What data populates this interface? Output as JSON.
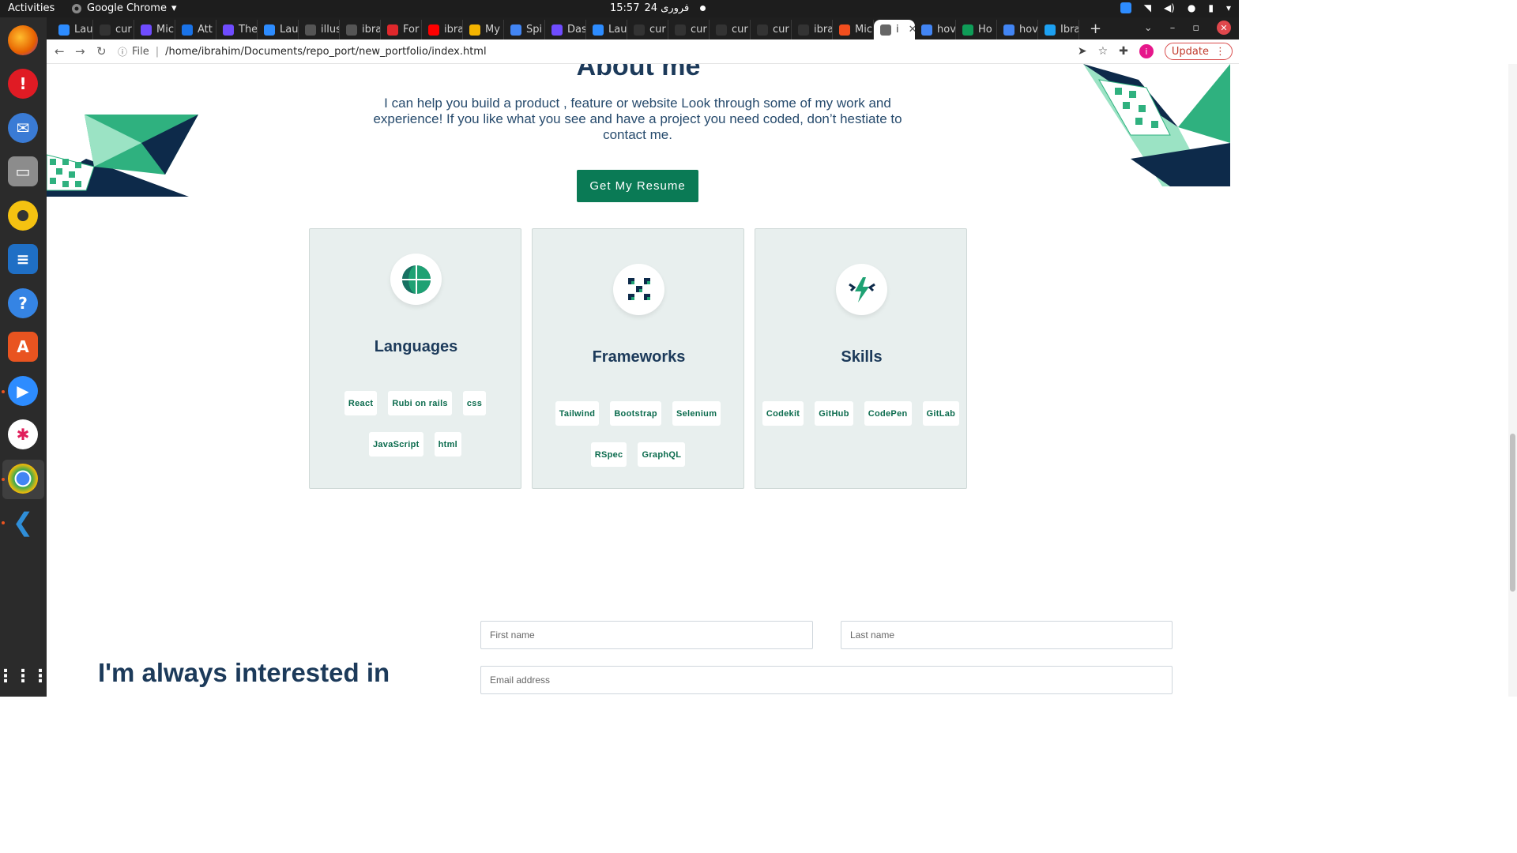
{
  "system": {
    "activities": "Activities",
    "app_name": "Google Chrome",
    "clock": "15:57",
    "date": "24 فروری"
  },
  "browser": {
    "tabs": [
      {
        "label": "Lau",
        "color": "#2d8cff"
      },
      {
        "label": "cur",
        "color": "#333333"
      },
      {
        "label": "Mic",
        "color": "#6f4cff"
      },
      {
        "label": "Att",
        "color": "#1a73e8"
      },
      {
        "label": "The",
        "color": "#6f4cff"
      },
      {
        "label": "Lau",
        "color": "#2d8cff"
      },
      {
        "label": "illus",
        "color": "#555555"
      },
      {
        "label": "ibra",
        "color": "#555555"
      },
      {
        "label": "For",
        "color": "#e0282c"
      },
      {
        "label": "ibra",
        "color": "#ff0000"
      },
      {
        "label": "My",
        "color": "#f4b400"
      },
      {
        "label": "Spi",
        "color": "#4285f4"
      },
      {
        "label": "Das",
        "color": "#6f4cff"
      },
      {
        "label": "Lau",
        "color": "#2d8cff"
      },
      {
        "label": "cur",
        "color": "#333333"
      },
      {
        "label": "cur",
        "color": "#333333"
      },
      {
        "label": "cur",
        "color": "#333333"
      },
      {
        "label": "cur",
        "color": "#333333"
      },
      {
        "label": "ibra",
        "color": "#333333"
      },
      {
        "label": "Mic",
        "color": "#f24e1e"
      },
      {
        "label": "i",
        "color": "#666666",
        "active": true
      },
      {
        "label": "hov",
        "color": "#4285f4"
      },
      {
        "label": "Ho",
        "color": "#0f9d58"
      },
      {
        "label": "hov",
        "color": "#4285f4"
      },
      {
        "label": "Ibra",
        "color": "#1da1f2"
      }
    ],
    "file_label": "File",
    "url": "/home/ibrahim/Documents/repo_port/new_portfolio/index.html",
    "update_label": "Update",
    "avatar_letter": "i"
  },
  "about": {
    "title": "About me",
    "text": "I can help you build a product , feature or website Look through some of my work and experience! If you like what you see and have a project you need coded, don’t hestiate to contact me.",
    "resume_button": "Get My Resume"
  },
  "cards": [
    {
      "title": "Languages",
      "icon": "globe-icon",
      "chips": [
        "React",
        "Rubi on rails",
        "css",
        "JavaScript",
        "html"
      ]
    },
    {
      "title": "Frameworks",
      "icon": "cubes-icon",
      "chips": [
        "Tailwind",
        "Bootstrap",
        "Selenium",
        "RSpec",
        "GraphQL"
      ]
    },
    {
      "title": "Skills",
      "icon": "bolt-icon",
      "chips": [
        "Codekit",
        "GitHub",
        "CodePen",
        "GitLab"
      ]
    }
  ],
  "contact": {
    "heading": "I'm always interested in",
    "first_name_placeholder": "First name",
    "last_name_placeholder": "Last name",
    "email_placeholder": "Email address"
  },
  "colors": {
    "accent": "#0a7a55",
    "heading": "#1c3a5a",
    "card_bg": "#e8efee"
  }
}
